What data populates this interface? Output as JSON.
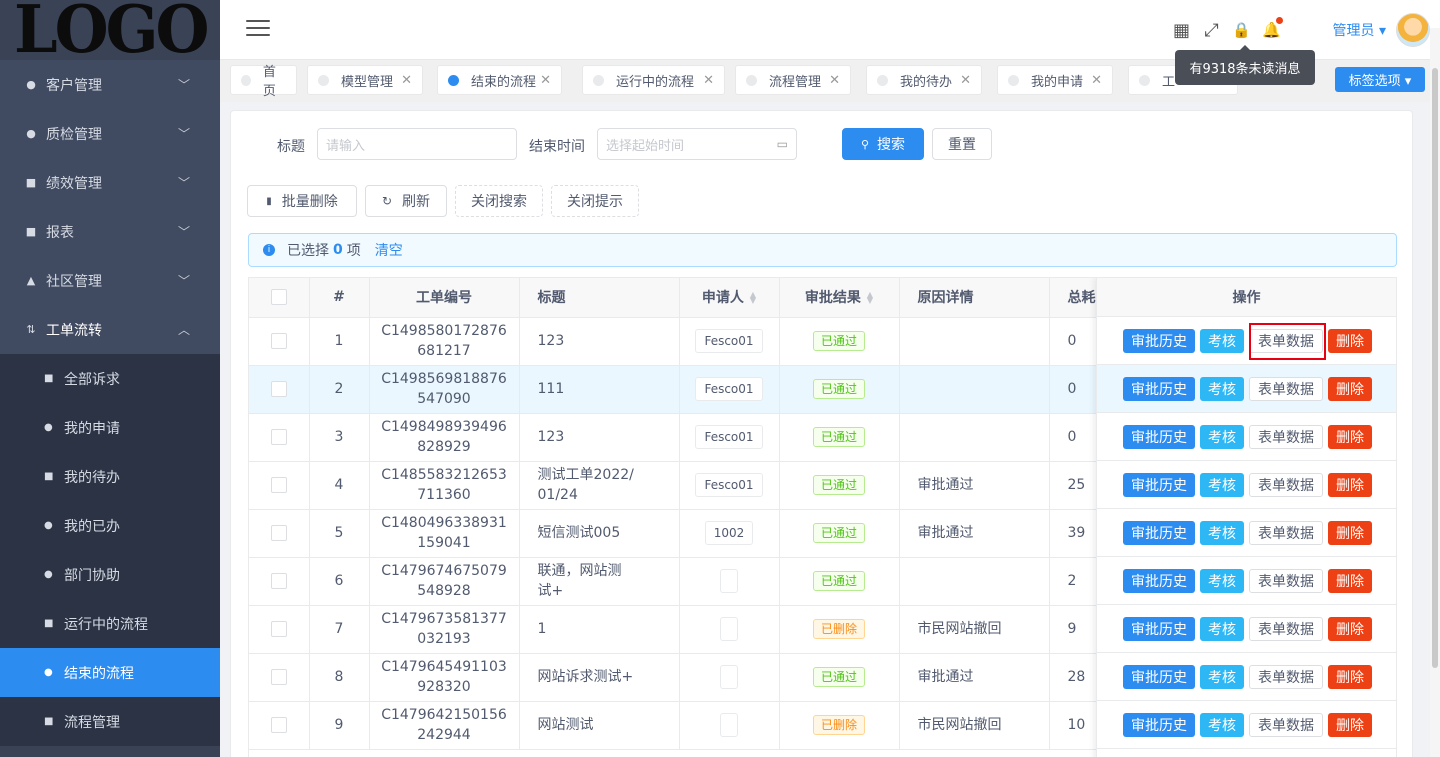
{
  "logo": "LOGO",
  "sidebar": {
    "menus": [
      {
        "label": "客户管理",
        "icon": "users-icon",
        "glyph": "●",
        "arrow": "﹀"
      },
      {
        "label": "质检管理",
        "icon": "quality-icon",
        "glyph": "●",
        "arrow": "﹀"
      },
      {
        "label": "绩效管理",
        "icon": "chart-icon",
        "glyph": "■",
        "arrow": "﹀"
      },
      {
        "label": "报表",
        "icon": "report-icon",
        "glyph": "■",
        "arrow": "﹀"
      },
      {
        "label": "社区管理",
        "icon": "home-icon",
        "glyph": "▲",
        "arrow": "﹀"
      },
      {
        "label": "工单流转",
        "icon": "flow-icon",
        "glyph": "⇅",
        "arrow": "︿"
      }
    ],
    "submenu": [
      {
        "label": "全部诉求",
        "glyph": "■"
      },
      {
        "label": "我的申请",
        "glyph": "●"
      },
      {
        "label": "我的待办",
        "glyph": "■"
      },
      {
        "label": "我的已办",
        "glyph": "●"
      },
      {
        "label": "部门协助",
        "glyph": "●"
      },
      {
        "label": "运行中的流程",
        "glyph": "■"
      },
      {
        "label": "结束的流程",
        "glyph": "●"
      },
      {
        "label": "流程管理",
        "glyph": "■"
      }
    ]
  },
  "header": {
    "admin": "管理员 ▾",
    "tooltip": "有9318条未读消息",
    "icons": {
      "apps": "▦",
      "fullscreen": "⤢",
      "lock": "🔒",
      "bell": "🔔"
    }
  },
  "tabs": [
    {
      "label": "首页",
      "close": ""
    },
    {
      "label": "模型管理",
      "close": "✕"
    },
    {
      "label": "结束的流程",
      "close": "✕"
    },
    {
      "label": "运行中的流程",
      "close": "✕"
    },
    {
      "label": "流程管理",
      "close": "✕"
    },
    {
      "label": "我的待办",
      "close": "✕"
    },
    {
      "label": "我的申请",
      "close": "✕"
    },
    {
      "label": "工",
      "close": ""
    }
  ],
  "tab_options": "标签选项 ▾",
  "search": {
    "title_label": "标题",
    "title_placeholder": "请输入",
    "end_time_label": "结束时间",
    "end_time_placeholder": "选择起始时间",
    "search_btn": "搜索",
    "reset_btn": "重置"
  },
  "toolbar": {
    "batch_delete": "批量删除",
    "refresh": "刷新",
    "close_search": "关闭搜索",
    "close_tip": "关闭提示"
  },
  "alert": {
    "prefix": "已选择",
    "count": "0",
    "suffix": "项",
    "clear": "清空"
  },
  "table": {
    "headers": [
      "#",
      "工单编号",
      "标题",
      "申请人",
      "审批结果",
      "原因详情",
      "总耗"
    ],
    "ops_header": "操作",
    "ops_buttons": {
      "history": "审批历史",
      "check": "考核",
      "form": "表单数据",
      "delete": "删除"
    },
    "rows": [
      {
        "no": "1",
        "id": "C1498580172876681217",
        "id1": "C1498580172876",
        "id2": "681217",
        "title": "123",
        "title2": "",
        "user": "Fesco01",
        "result": "已通过",
        "status": "ok",
        "reason": "",
        "total": "0"
      },
      {
        "no": "2",
        "id1": "C1498569818876",
        "id2": "547090",
        "title": "111",
        "title2": "",
        "user": "Fesco01",
        "result": "已通过",
        "status": "ok",
        "reason": "",
        "total": "0"
      },
      {
        "no": "3",
        "id1": "C1498498939496",
        "id2": "828929",
        "title": "123",
        "title2": "",
        "user": "Fesco01",
        "result": "已通过",
        "status": "ok",
        "reason": "",
        "total": "0"
      },
      {
        "no": "4",
        "id1": "C1485583212653",
        "id2": "711360",
        "title": "测试工单2022/",
        "title2": "01/24",
        "user": "Fesco01",
        "result": "已通过",
        "status": "ok",
        "reason": "审批通过",
        "total": "25"
      },
      {
        "no": "5",
        "id1": "C1480496338931",
        "id2": "159041",
        "title": "短信测试005",
        "title2": "",
        "user": "1002",
        "result": "已通过",
        "status": "ok",
        "reason": "审批通过",
        "total": "39"
      },
      {
        "no": "6",
        "id1": "C1479674675079",
        "id2": "548928",
        "title": "联通，网站测",
        "title2": "试+",
        "user": "",
        "result": "已通过",
        "status": "ok",
        "reason": "",
        "total": "2"
      },
      {
        "no": "7",
        "id1": "C1479673581377",
        "id2": "032193",
        "title": "1",
        "title2": "",
        "user": "",
        "result": "已删除",
        "status": "del",
        "reason": "市民网站撤回",
        "total": "9"
      },
      {
        "no": "8",
        "id1": "C1479645491103",
        "id2": "928320",
        "title": "网站诉求测试+",
        "title2": "",
        "user": "",
        "result": "已通过",
        "status": "ok",
        "reason": "审批通过",
        "total": "28"
      },
      {
        "no": "9",
        "id1": "C1479642150156",
        "id2": "242944",
        "title": "网站测试",
        "title2": "",
        "user": "",
        "result": "已删除",
        "status": "del",
        "reason": "市民网站撤回",
        "total": "10"
      }
    ]
  },
  "colors": {
    "primary": "#2d8cf0",
    "sidebar": "#3a4356",
    "danger": "#ed4014",
    "info": "#2db7f5"
  }
}
